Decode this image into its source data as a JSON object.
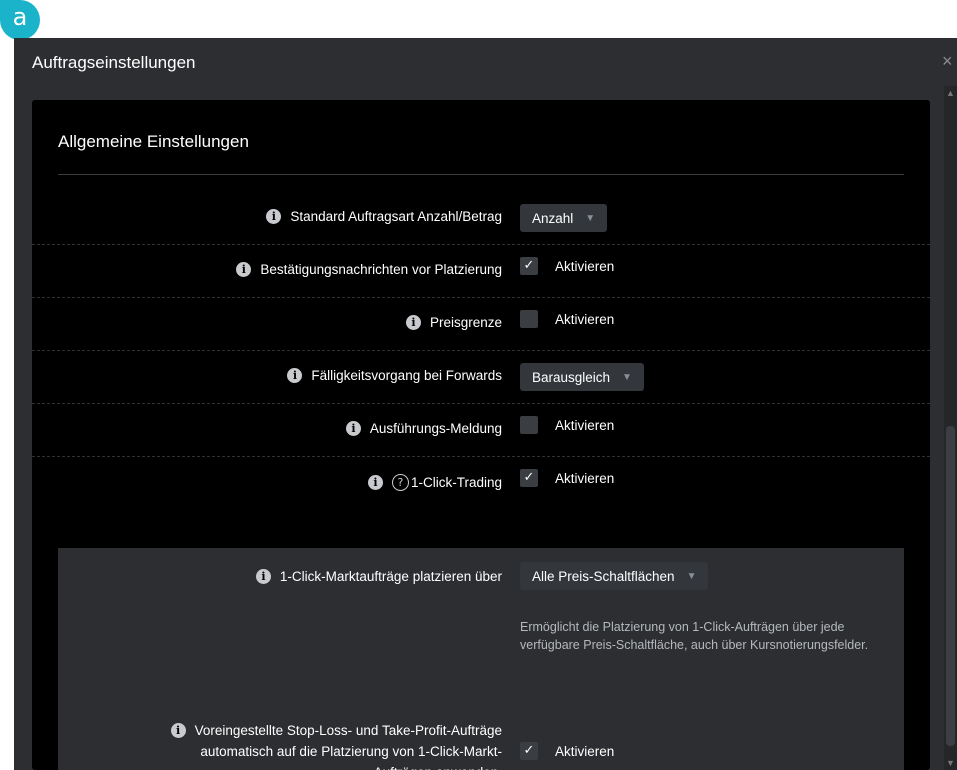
{
  "badge": {
    "letter": "a"
  },
  "window": {
    "title": "Auftragseinstellungen",
    "close": "×"
  },
  "section": {
    "title": "Allgemeine Einstellungen"
  },
  "rows": [
    {
      "label": "Standard Auftragsart Anzahl/Betrag",
      "control": "dropdown",
      "value": "Anzahl"
    },
    {
      "label": "Bestätigungsnachrichten vor Platzierung",
      "control": "checkbox",
      "checked": true,
      "option": "Aktivieren"
    },
    {
      "label": "Preisgrenze",
      "control": "checkbox",
      "checked": false,
      "option": "Aktivieren"
    },
    {
      "label": "Fälligkeitsvorgang bei Forwards",
      "control": "dropdown",
      "value": "Barausgleich"
    },
    {
      "label": "Ausführungs-Meldung",
      "control": "checkbox",
      "checked": false,
      "option": "Aktivieren"
    },
    {
      "label": "1-Click-Trading",
      "help": "?",
      "control": "checkbox",
      "checked": true,
      "option": "Aktivieren"
    }
  ],
  "one_click": {
    "market_label": "1-Click-Marktaufträge platzieren über",
    "market_value": "Alle Preis-Schaltflächen",
    "description": "Ermöglicht die Platzierung von 1-Click-Aufträgen über jede verfügbare Preis-Schaltfläche, auch über Kursnotierungsfelder.",
    "stoploss_label_line1": "Voreingestellte Stop-Loss- und Take-Profit-Aufträge",
    "stoploss_label_line2": "automatisch auf die Platzierung von 1-Click-Markt-",
    "stoploss_label_line3": "Aufträgen anwenden.",
    "stoploss_checked": true,
    "stoploss_option": "Aktivieren"
  },
  "icons": {
    "info": "i",
    "check": "✓",
    "caret": "▼",
    "scroll_up": "▲",
    "scroll_down": "▼"
  },
  "colors": {
    "badge": "#1ab3c9",
    "window_bg": "#2c2e31",
    "panel_bg": "#000000",
    "dropdown_bg": "#33373c"
  }
}
